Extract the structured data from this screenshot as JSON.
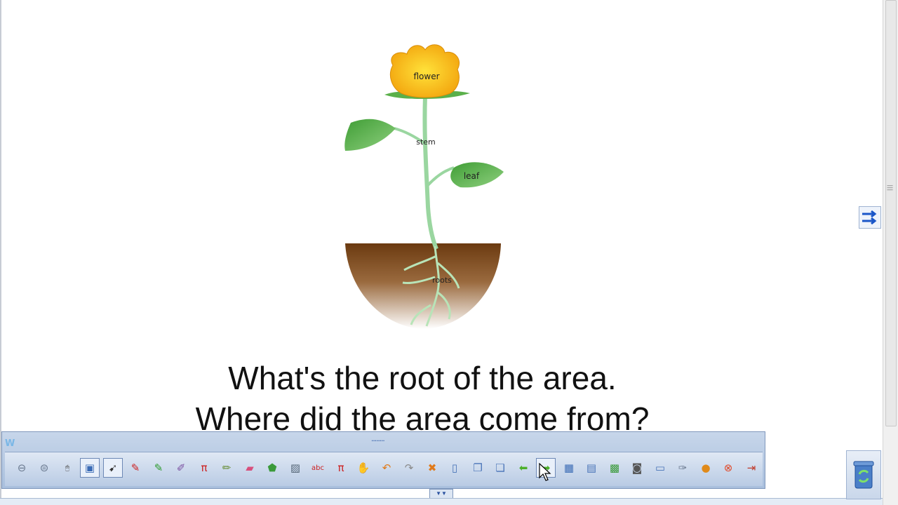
{
  "diagram": {
    "labels": {
      "flower": "flower",
      "stem": "stem",
      "leaf": "leaf",
      "roots": "roots"
    }
  },
  "caption": {
    "line1": "What's the root of the area.",
    "line2": "Where did the area come from?"
  },
  "toolbar": {
    "logo": "W",
    "grip": "........",
    "tools": [
      {
        "icon": "zoom-out-icon",
        "glyph": "⊖",
        "color": "#6b7a90"
      },
      {
        "icon": "zoom-down-icon",
        "glyph": "⊜",
        "color": "#6b7a90"
      },
      {
        "icon": "mouse-icon",
        "glyph": "🖱",
        "color": "#555555"
      },
      {
        "icon": "copy-page-icon",
        "glyph": "▣",
        "color": "#3a6bb5",
        "selected": true
      },
      {
        "icon": "select-arrow-icon",
        "glyph": "➹",
        "color": "#333333",
        "selected": true
      },
      {
        "icon": "red-pen-icon",
        "glyph": "✎",
        "color": "#cc2222"
      },
      {
        "icon": "green-pen-icon",
        "glyph": "✎",
        "color": "#2b9a2b"
      },
      {
        "icon": "text-pen-icon",
        "glyph": "✐",
        "color": "#7a4fa0"
      },
      {
        "icon": "math-pen-icon",
        "glyph": "π",
        "color": "#cc2222"
      },
      {
        "icon": "highlighter-icon",
        "glyph": "✏",
        "color": "#6a8f3a"
      },
      {
        "icon": "eraser-icon",
        "glyph": "▰",
        "color": "#d84f7c"
      },
      {
        "icon": "shape-fill-icon",
        "glyph": "⬟",
        "color": "#3a9a3a"
      },
      {
        "icon": "ruler-icon",
        "glyph": "▨",
        "color": "#556677"
      },
      {
        "icon": "text-recognition-icon",
        "glyph": "abc",
        "color": "#cc2222"
      },
      {
        "icon": "math-recognition-icon",
        "glyph": "π",
        "color": "#cc2222"
      },
      {
        "icon": "hand-pan-icon",
        "glyph": "✋",
        "color": "#c98a3a"
      },
      {
        "icon": "undo-icon",
        "glyph": "↶",
        "color": "#e07a1a"
      },
      {
        "icon": "redo-icon",
        "glyph": "↷",
        "color": "#8a8a8a"
      },
      {
        "icon": "delete-icon",
        "glyph": "✖",
        "color": "#e07a1a"
      },
      {
        "icon": "new-page-icon",
        "glyph": "▯",
        "color": "#4a74b8"
      },
      {
        "icon": "duplicate-page-icon",
        "glyph": "❐",
        "color": "#4a74b8"
      },
      {
        "icon": "pages-icon",
        "glyph": "❏",
        "color": "#4a74b8"
      },
      {
        "icon": "previous-page-icon",
        "glyph": "⬅",
        "color": "#4caf2a"
      },
      {
        "icon": "next-page-icon",
        "glyph": "➡",
        "color": "#4caf2a",
        "selected": true
      },
      {
        "icon": "grid-icon",
        "glyph": "▦",
        "color": "#3a6bb5"
      },
      {
        "icon": "save-icon",
        "glyph": "▤",
        "color": "#4a74b8"
      },
      {
        "icon": "import-image-icon",
        "glyph": "▩",
        "color": "#3a9a3a"
      },
      {
        "icon": "camera-icon",
        "glyph": "◙",
        "color": "#555555"
      },
      {
        "icon": "folder-icon",
        "glyph": "▭",
        "color": "#4a74b8"
      },
      {
        "icon": "pen-settings-icon",
        "glyph": "✑",
        "color": "#6b7a90"
      },
      {
        "icon": "user-icon",
        "glyph": "●",
        "color": "#e08a1a"
      },
      {
        "icon": "close-icon",
        "glyph": "⊗",
        "color": "#e04a2a"
      },
      {
        "icon": "exit-icon",
        "glyph": "⇥",
        "color": "#c03a2a"
      }
    ],
    "collapse_glyph": "▼▼"
  }
}
